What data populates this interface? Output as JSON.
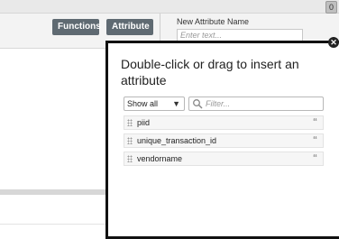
{
  "topbar": {
    "badge": "0"
  },
  "toolbar": {
    "functions_label": "Functions",
    "attribute_label": "Attribute",
    "new_attr_label": "New Attribute Name",
    "new_attr_placeholder": "Enter text..."
  },
  "popup": {
    "title": "Double-click or drag to insert an attribute",
    "close_glyph": "✕",
    "show_select": {
      "value": "Show all"
    },
    "filter_placeholder": "Filter...",
    "attributes": [
      {
        "label": "piid",
        "icon": "quote-icon",
        "glyph": "“"
      },
      {
        "label": "unique_transaction_id",
        "icon": "quote-icon",
        "glyph": "“"
      },
      {
        "label": "vendorname",
        "icon": "quote-icon",
        "glyph": "“"
      }
    ]
  },
  "colors": {
    "button_bg": "#5f6a72",
    "popup_border": "#111111"
  }
}
